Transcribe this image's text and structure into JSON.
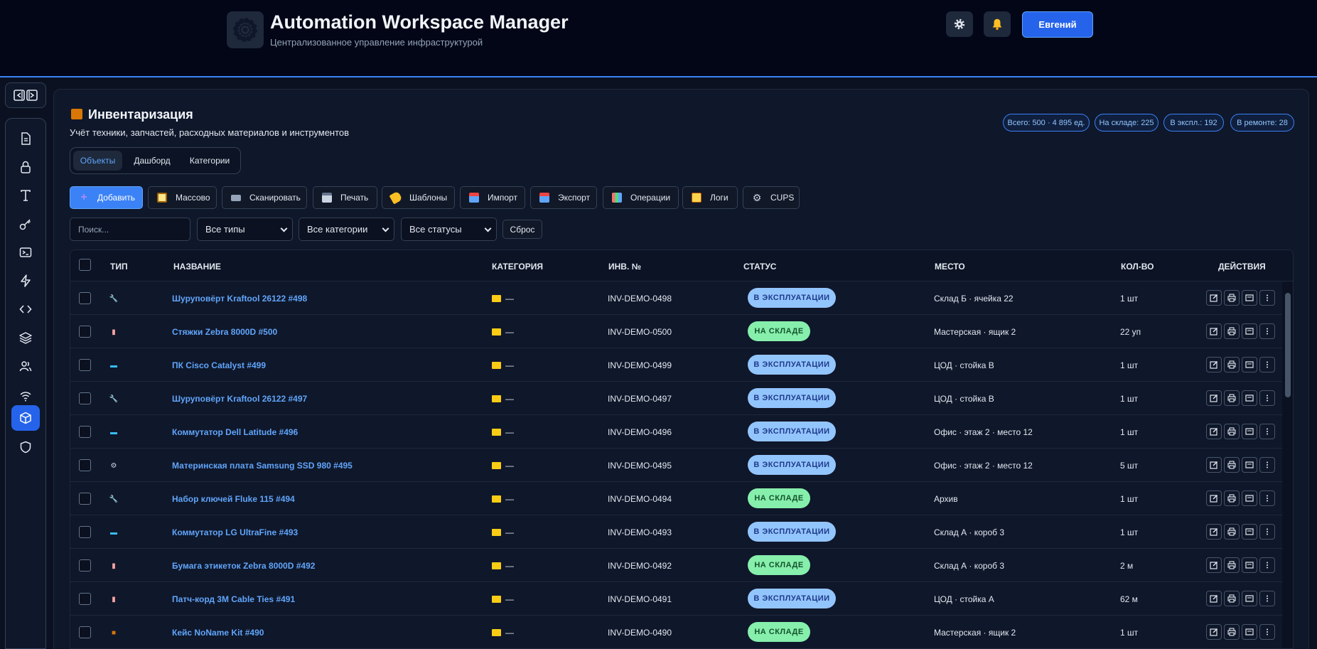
{
  "header": {
    "title": "Automation Workspace Manager",
    "subtitle": "Централизованное управление инфраструктурой",
    "user_label": "Евгений",
    "icons": [
      "gear-icon",
      "bell-icon"
    ]
  },
  "sidebar": {
    "items": [
      "document",
      "lock",
      "text",
      "key",
      "terminal",
      "bolt",
      "code",
      "layers",
      "users",
      "wifi",
      "box",
      "shield"
    ],
    "active": "box"
  },
  "section": {
    "title": "Инвентаризация",
    "subtitle": "Учёт техники, запчастей, расходных материалов и инструментов",
    "stats": [
      "Всего: 500 · 4 895 ед.",
      "На складе: 225",
      "В экспл.: 192",
      "В ремонте: 28"
    ]
  },
  "tabs": [
    "Объекты",
    "Дашборд",
    "Категории"
  ],
  "active_tab": "Объекты",
  "toolbar": [
    "Добавить",
    "Массово",
    "Сканировать",
    "Печать",
    "Шаблоны",
    "Импорт",
    "Экспорт",
    "Операции",
    "Логи",
    "CUPS"
  ],
  "filters": {
    "search_placeholder": "Поиск...",
    "type": "Все типы",
    "category": "Все категории",
    "status": "Все статусы",
    "reset": "Сброс"
  },
  "table": {
    "headers": [
      "ТИП",
      "НАЗВАНИЕ",
      "КАТЕГОРИЯ",
      "ИНВ. №",
      "СТАТУС",
      "МЕСТО",
      "КОЛ-ВО",
      "ДЕЙСТВИЯ"
    ],
    "rows": [
      {
        "type": "tool",
        "name": "Шуруповёрт Kraftool 26122 #498",
        "category": "—",
        "inv": "INV-DEMO-0498",
        "status": "В ЭКСПЛУАТАЦИИ",
        "status_kind": "exp",
        "place": "Склад Б · ячейка 22",
        "qty": "1 шт"
      },
      {
        "type": "consumable",
        "name": "Стяжки Zebra 8000D #500",
        "category": "—",
        "inv": "INV-DEMO-0500",
        "status": "НА СКЛАДЕ",
        "status_kind": "stk",
        "place": "Мастерская · ящик 2",
        "qty": "22 уп"
      },
      {
        "type": "computer",
        "name": "ПК Cisco Catalyst #499",
        "category": "—",
        "inv": "INV-DEMO-0499",
        "status": "В ЭКСПЛУАТАЦИИ",
        "status_kind": "exp",
        "place": "ЦОД · стойка B",
        "qty": "1 шт"
      },
      {
        "type": "tool",
        "name": "Шуруповёрт Kraftool 26122 #497",
        "category": "—",
        "inv": "INV-DEMO-0497",
        "status": "В ЭКСПЛУАТАЦИИ",
        "status_kind": "exp",
        "place": "ЦОД · стойка B",
        "qty": "1 шт"
      },
      {
        "type": "computer",
        "name": "Коммутатор Dell Latitude #496",
        "category": "—",
        "inv": "INV-DEMO-0496",
        "status": "В ЭКСПЛУАТАЦИИ",
        "status_kind": "exp",
        "place": "Офис · этаж 2 · место 12",
        "qty": "1 шт"
      },
      {
        "type": "part",
        "name": "Материнская плата Samsung SSD 980 #495",
        "category": "—",
        "inv": "INV-DEMO-0495",
        "status": "В ЭКСПЛУАТАЦИИ",
        "status_kind": "exp",
        "place": "Офис · этаж 2 · место 12",
        "qty": "5 шт"
      },
      {
        "type": "tool",
        "name": "Набор ключей Fluke 115 #494",
        "category": "—",
        "inv": "INV-DEMO-0494",
        "status": "НА СКЛАДЕ",
        "status_kind": "stk",
        "place": "Архив",
        "qty": "1 шт"
      },
      {
        "type": "computer",
        "name": "Коммутатор LG UltraFine #493",
        "category": "—",
        "inv": "INV-DEMO-0493",
        "status": "В ЭКСПЛУАТАЦИИ",
        "status_kind": "exp",
        "place": "Склад А · короб 3",
        "qty": "1 шт"
      },
      {
        "type": "consumable",
        "name": "Бумага этикеток Zebra 8000D #492",
        "category": "—",
        "inv": "INV-DEMO-0492",
        "status": "НА СКЛАДЕ",
        "status_kind": "stk",
        "place": "Склад А · короб 3",
        "qty": "2 м"
      },
      {
        "type": "consumable",
        "name": "Патч-корд 3M Cable Ties #491",
        "category": "—",
        "inv": "INV-DEMO-0491",
        "status": "В ЭКСПЛУАТАЦИИ",
        "status_kind": "exp",
        "place": "ЦОД · стойка A",
        "qty": "62 м"
      },
      {
        "type": "box",
        "name": "Кейс NoName Kit #490",
        "category": "—",
        "inv": "INV-DEMO-0490",
        "status": "НА СКЛАДЕ",
        "status_kind": "stk",
        "place": "Мастерская · ящик 2",
        "qty": "1 шт"
      }
    ]
  },
  "colors": {
    "accent": "#3b82f6",
    "status_in_use": "#93c5fd",
    "status_in_stock": "#86efac",
    "link": "#60a5fa"
  }
}
